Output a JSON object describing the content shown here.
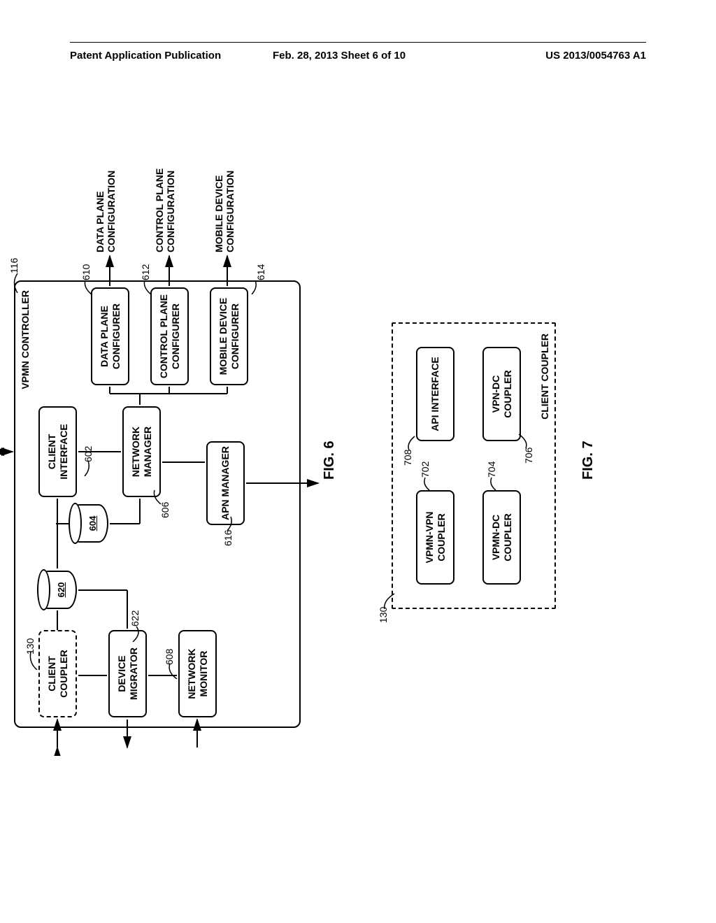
{
  "header": {
    "left": "Patent Application Publication",
    "center": "Feb. 28, 2013  Sheet 6 of 10",
    "right": "US 2013/0054763 A1"
  },
  "fig6": {
    "caption": "FIG. 6",
    "title": "VPMN CONTROLLER",
    "title_ref": "116",
    "blocks": {
      "client_coupler": {
        "label": "CLIENT COUPLER",
        "ref": "130"
      },
      "device_migrator": {
        "label": "DEVICE MIGRATOR",
        "ref": "622"
      },
      "network_monitor": {
        "label": "NETWORK MONITOR",
        "ref": "608"
      },
      "client_interface": {
        "label": "CLIENT INTERFACE",
        "ref": "602"
      },
      "network_manager": {
        "label": "NETWORK MANAGER",
        "ref": "606"
      },
      "apn_manager": {
        "label": "APN MANAGER",
        "ref": "616"
      },
      "data_plane_cfg": {
        "label": "DATA PLANE CONFIGURER",
        "ref": "610"
      },
      "control_plane_cfg": {
        "label": "CONTROL PLANE CONFIGURER",
        "ref": "612"
      },
      "mobile_device_cfg": {
        "label": "MOBILE DEVICE CONFIGURER",
        "ref": "614"
      },
      "db_620": {
        "label": "620"
      },
      "db_604": {
        "label": "604"
      }
    },
    "outputs": {
      "data_plane": "DATA PLANE CONFIGURATION",
      "control_plane": "CONTROL PLANE CONFIGURATION",
      "mobile_device": "MOBILE DEVICE CONFIGURATION"
    }
  },
  "fig7": {
    "caption": "FIG. 7",
    "title": "CLIENT COUPLER",
    "title_ref": "130",
    "blocks": {
      "vpmn_vpn": {
        "label": "VPMN-VPN COUPLER",
        "ref": "702"
      },
      "vpmn_dc": {
        "label": "VPMN-DC COUPLER",
        "ref": "704"
      },
      "api_interface": {
        "label": "API INTERFACE",
        "ref": "708"
      },
      "vpn_dc": {
        "label": "VPN-DC COUPLER",
        "ref": "706"
      }
    }
  }
}
